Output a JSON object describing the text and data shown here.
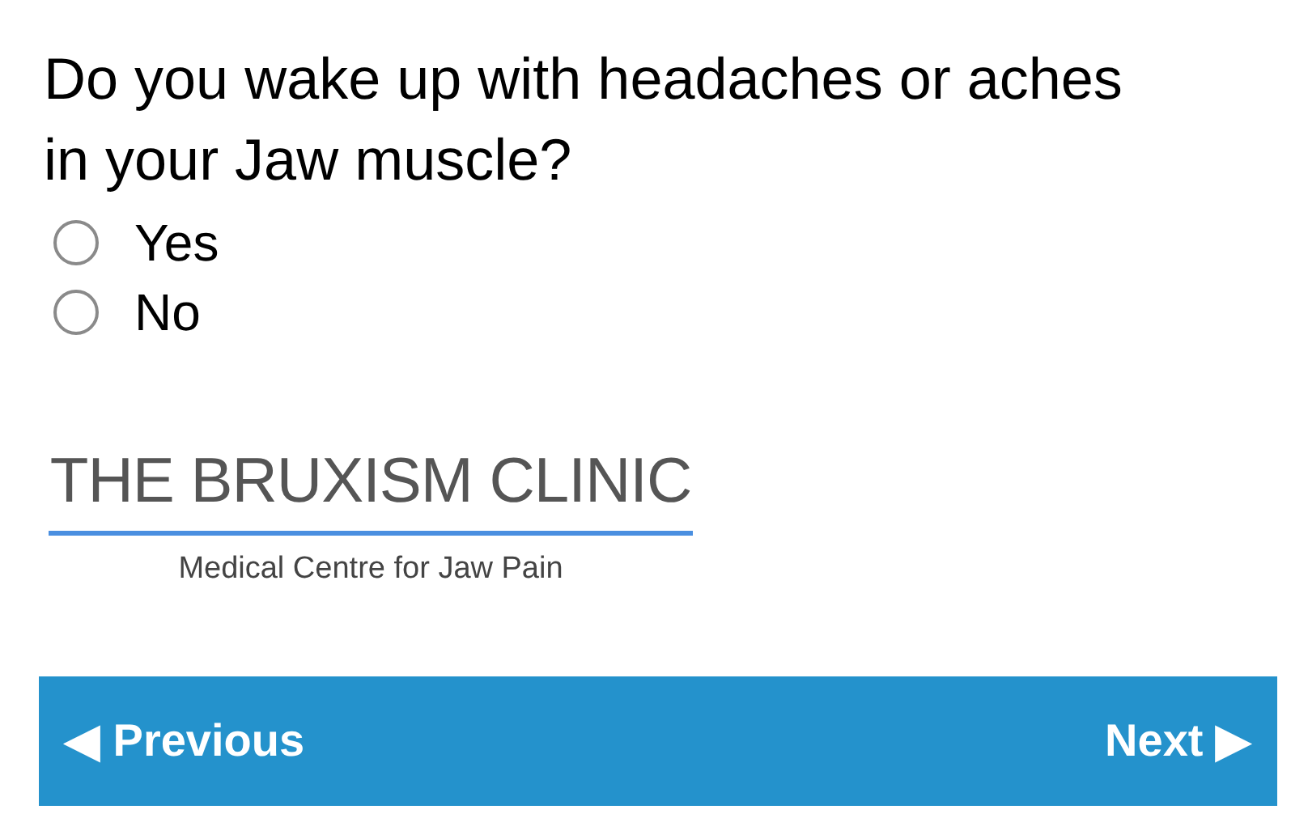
{
  "question": "Do you wake up with headaches or aches in your Jaw muscle?",
  "options": [
    {
      "label": "Yes",
      "selected": false
    },
    {
      "label": "No",
      "selected": false
    }
  ],
  "logo": {
    "title": "THE BRUXISM CLINIC",
    "subtitle": "Medical Centre for Jaw Pain"
  },
  "navigation": {
    "previous": "◀ Previous",
    "next": "Next ▶"
  }
}
